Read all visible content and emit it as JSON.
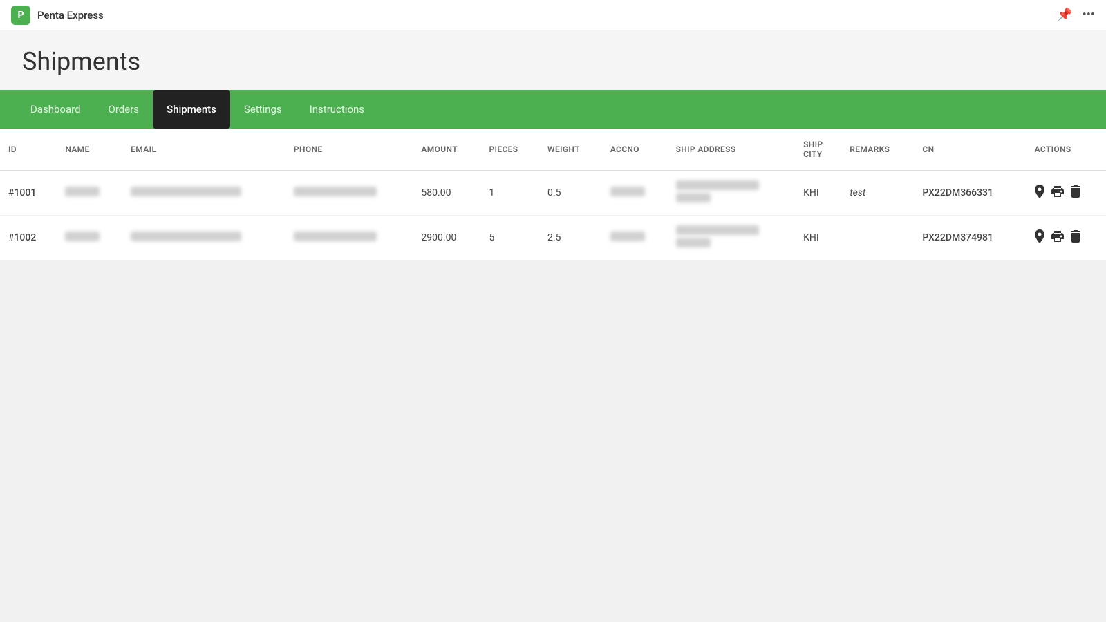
{
  "app": {
    "icon_letter": "P",
    "title": "Penta Express"
  },
  "topbar": {
    "pin_icon": "📌",
    "more_icon": "•••"
  },
  "page": {
    "title": "Shipments"
  },
  "nav": {
    "items": [
      {
        "id": "dashboard",
        "label": "Dashboard",
        "active": false
      },
      {
        "id": "orders",
        "label": "Orders",
        "active": false
      },
      {
        "id": "shipments",
        "label": "Shipments",
        "active": true
      },
      {
        "id": "settings",
        "label": "Settings",
        "active": false
      },
      {
        "id": "instructions",
        "label": "Instructions",
        "active": false
      }
    ]
  },
  "table": {
    "columns": [
      {
        "id": "id",
        "label": "ID"
      },
      {
        "id": "name",
        "label": "NAME"
      },
      {
        "id": "email",
        "label": "EMAIL"
      },
      {
        "id": "phone",
        "label": "PHONE"
      },
      {
        "id": "amount",
        "label": "AMOUNT"
      },
      {
        "id": "pieces",
        "label": "PIECES"
      },
      {
        "id": "weight",
        "label": "WEIGHT"
      },
      {
        "id": "accno",
        "label": "ACCNO"
      },
      {
        "id": "ship_address",
        "label": "SHIP ADDRESS"
      },
      {
        "id": "ship_city",
        "label": "SHIP CITY"
      },
      {
        "id": "remarks",
        "label": "REMARKS"
      },
      {
        "id": "cn",
        "label": "CN"
      },
      {
        "id": "actions",
        "label": "ACTIONS"
      }
    ],
    "rows": [
      {
        "id": "#1001",
        "name": "REDACTED",
        "email": "REDACTED",
        "phone": "REDACTED",
        "amount": "580.00",
        "pieces": "1",
        "weight": "0.5",
        "accno": "REDACTED",
        "ship_address": "REDACTED",
        "ship_city": "KHI",
        "remarks": "test",
        "cn": "PX22DM366331"
      },
      {
        "id": "#1002",
        "name": "REDACTED",
        "email": "REDACTED",
        "phone": "REDACTED",
        "amount": "2900.00",
        "pieces": "5",
        "weight": "2.5",
        "accno": "REDACTED",
        "ship_address": "REDACTED",
        "ship_city": "KHI",
        "remarks": "",
        "cn": "PX22DM374981"
      }
    ]
  },
  "colors": {
    "green": "#4caf50",
    "active_tab_bg": "#222222"
  }
}
